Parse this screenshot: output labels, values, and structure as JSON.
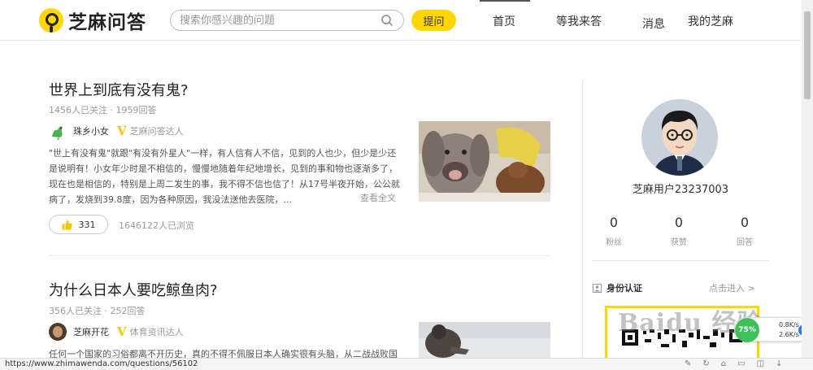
{
  "header": {
    "logo_text": "芝麻问答",
    "search_placeholder": "搜索你感兴趣的问题",
    "ask_label": "提问",
    "nav": [
      {
        "label": "首页",
        "active": true
      },
      {
        "label": "等我来答"
      },
      {
        "label": "消息"
      },
      {
        "label": "我的芝麻"
      }
    ]
  },
  "feed": [
    {
      "title": "世界上到底有没有鬼?",
      "meta": "1456人已关注 · 1959回答",
      "author": "珠乡小女",
      "author_tag": "芝麻问答达人",
      "excerpt": "\"世上有没有鬼\"就跟\"有没有外星人\"一样，有人信有人不信，见到的人也少，但少是少还是说明有！小女年少时是不相信的，慢慢地随着年纪地增长，见到的事和物也逐渐多了，现在也是相信的，特别是上周二发生的事，我不得不信也信了！从17号半夜开始，公公就病了，发烧到39.8度，因为各种原因，我没法送他去医院，...",
      "read_all": "查看全文",
      "likes": "331",
      "views": "1646122人已浏览"
    },
    {
      "title": "为什么日本人要吃鲸鱼肉?",
      "meta": "356人已关注 · 252回答",
      "author": "芝麻开花",
      "author_tag": "体育资讯达人",
      "excerpt": "任何一个国家的习俗都离不开历史，真的不得不佩服日本人确实很有头脑，从二战战败国"
    }
  ],
  "sidebar": {
    "username": "芝麻用户23237003",
    "stats": [
      {
        "num": "0",
        "label": "粉丝"
      },
      {
        "num": "0",
        "label": "获赞"
      },
      {
        "num": "0",
        "label": "回答"
      }
    ],
    "identity_title": "身份认证",
    "identity_link": "点击进入 >"
  },
  "status": {
    "url": "https://www.zhimawenda.com/questions/56102"
  },
  "speed_widget": {
    "percent": "75%",
    "up": "0.8K/s",
    "down": "2.6K/s"
  },
  "watermark": "Baidu 经验",
  "colors": {
    "accent": "#ffd600",
    "author_v": "#f5c400",
    "speed_green": "#3fc15a"
  }
}
